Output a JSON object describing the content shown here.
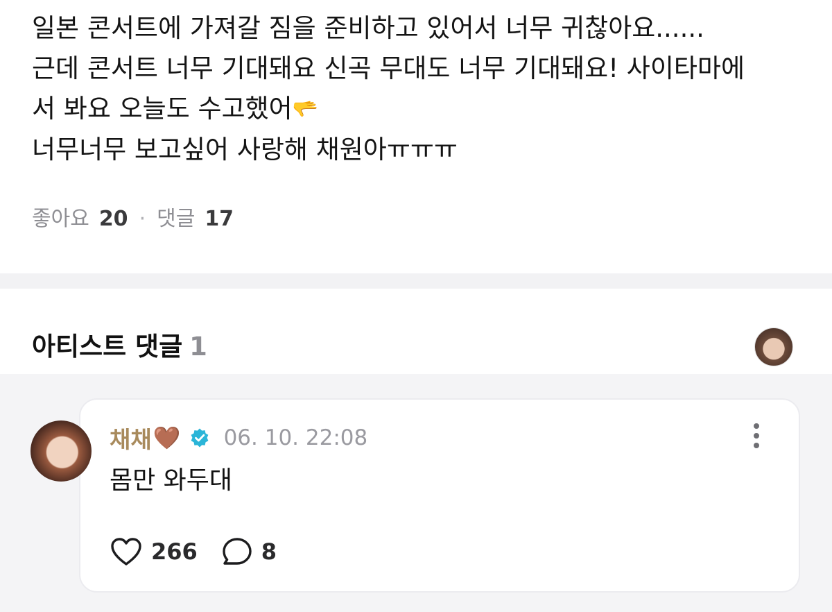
{
  "post": {
    "lines": [
      "일본 콘서트에 가져갈 짐을 준비하고 있어서 너무 귀찮아요......",
      "근데 콘서트 너무 기대돼요 신곡 무대도 너무 기대돼요! 사이타마에",
      "서 봐요 오늘도 수고했어",
      "너무너무 보고싶어 사랑해 채원아ㅠㅠㅠ"
    ],
    "hand_emoji": "🫳",
    "likes_label": "좋아요",
    "likes_count": "20",
    "separator": "·",
    "comments_label": "댓글",
    "comments_count": "17"
  },
  "artist_comments": {
    "title": "아티스트 댓글",
    "count": "1"
  },
  "comment": {
    "author": "채채",
    "author_emoji": "🤎",
    "verified_icon": "verified-badge-icon",
    "timestamp": "06. 10. 22:08",
    "text": "몸만 와두대",
    "likes": "266",
    "replies": "8"
  },
  "colors": {
    "author_name": "#a88a5c",
    "verified": "#2bb5d8",
    "divider": "#f2f2f4",
    "comment_area": "#f4f4f6"
  }
}
